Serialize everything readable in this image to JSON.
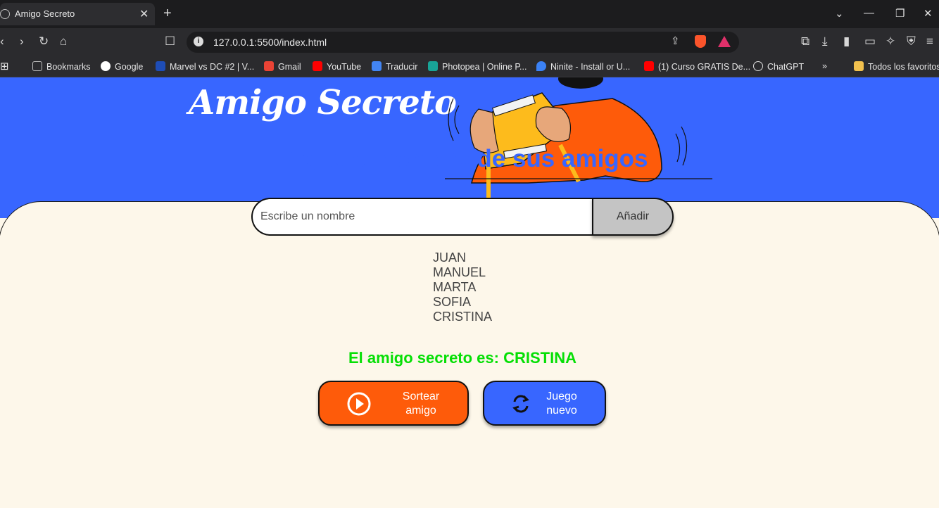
{
  "browser": {
    "tab_title": "Amigo Secreto",
    "url": "127.0.0.1:5500/index.html",
    "bookmarks": [
      {
        "label": "Bookmarks",
        "color": "#888888"
      },
      {
        "label": "Google",
        "color": "#ffffff"
      },
      {
        "label": "Marvel vs DC #2 | V...",
        "color": "#1e4db7"
      },
      {
        "label": "Gmail",
        "color": "#ea4335"
      },
      {
        "label": "YouTube",
        "color": "#ff0000"
      },
      {
        "label": "Traducir",
        "color": "#4285f4"
      },
      {
        "label": "Photopea | Online P...",
        "color": "#18a497"
      },
      {
        "label": "Ninite - Install or U...",
        "color": "#3b82f6"
      },
      {
        "label": "(1) Curso GRATIS De...",
        "color": "#ff0000"
      },
      {
        "label": "ChatGPT",
        "color": "#dddddd"
      }
    ],
    "all_bookmarks_label": "Todos los favoritos"
  },
  "page": {
    "banner_title": "Amigo Secreto",
    "heading": "Digite el nombre de sus amigos",
    "input_placeholder": "Escribe un nombre",
    "input_value": "",
    "add_button_label": "Añadir",
    "friends": [
      "JUAN",
      "MANUEL",
      "MARTA",
      "SOFIA",
      "CRISTINA"
    ],
    "result_text": "El amigo secreto es: CRISTINA",
    "draw_button": {
      "line1": "Sortear",
      "line2": "amigo"
    },
    "new_game_button": {
      "line1": "Juego",
      "line2": "nuevo"
    }
  },
  "colors": {
    "banner": "#3866ff",
    "heading": "#3866ff",
    "result": "#05df05",
    "draw_button": "#fe5b0a",
    "new_game_button": "#3866ff",
    "card_background": "#fdf7ea"
  }
}
